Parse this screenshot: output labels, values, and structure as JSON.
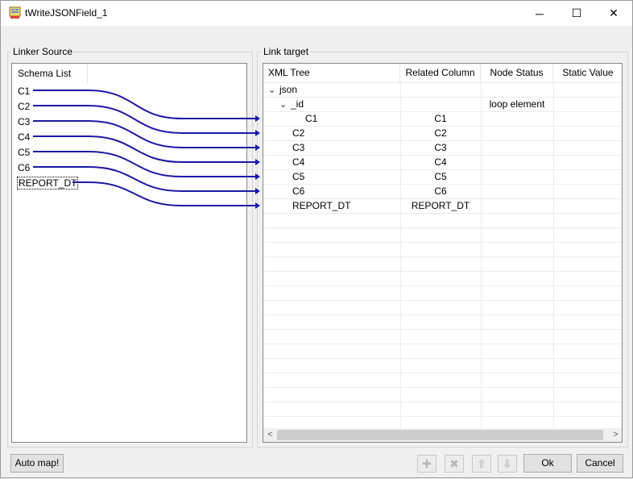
{
  "window": {
    "title": "tWriteJSONField_1",
    "app_icon": "component-icon",
    "controls": {
      "minimize": "─",
      "maximize": "☐",
      "close": "✕"
    }
  },
  "source_group": {
    "legend": "Linker Source",
    "header": "Schema List",
    "items": [
      "C1",
      "C2",
      "C3",
      "C4",
      "C5",
      "C6",
      "REPORT_DT"
    ]
  },
  "target_group": {
    "legend": "Link target",
    "columns": [
      "XML Tree",
      "Related Column",
      "Node Status",
      "Static Value"
    ],
    "rows": [
      {
        "tree": "json",
        "chevron": "⌄",
        "related": "",
        "status": "",
        "static": ""
      },
      {
        "tree": "_id",
        "chevron": "⌄",
        "related": "",
        "status": "loop element",
        "static": ""
      },
      {
        "tree": "C1",
        "chevron": "",
        "related": "C1",
        "status": "",
        "static": ""
      },
      {
        "tree": "C2",
        "chevron": "",
        "related": "C2",
        "status": "",
        "static": ""
      },
      {
        "tree": "C3",
        "chevron": "",
        "related": "C3",
        "status": "",
        "static": ""
      },
      {
        "tree": "C4",
        "chevron": "",
        "related": "C4",
        "status": "",
        "static": ""
      },
      {
        "tree": "C5",
        "chevron": "",
        "related": "C5",
        "status": "",
        "static": ""
      },
      {
        "tree": "C6",
        "chevron": "",
        "related": "C6",
        "status": "",
        "static": ""
      },
      {
        "tree": "REPORT_DT",
        "chevron": "",
        "related": "REPORT_DT",
        "status": "",
        "static": ""
      }
    ],
    "scroll_left": "<",
    "scroll_right": ">"
  },
  "links": [
    {
      "from": "C1",
      "to": "C1"
    },
    {
      "from": "C2",
      "to": "C2"
    },
    {
      "from": "C3",
      "to": "C3"
    },
    {
      "from": "C4",
      "to": "C4"
    },
    {
      "from": "C5",
      "to": "C5"
    },
    {
      "from": "C6",
      "to": "C6"
    },
    {
      "from": "REPORT_DT",
      "to": "REPORT_DT"
    }
  ],
  "link_color": "#1a1aa6",
  "buttons": {
    "auto_map": "Auto map!",
    "add": "✚",
    "remove": "✖",
    "up": "⇧",
    "down": "⇩",
    "ok": "Ok",
    "cancel": "Cancel"
  }
}
